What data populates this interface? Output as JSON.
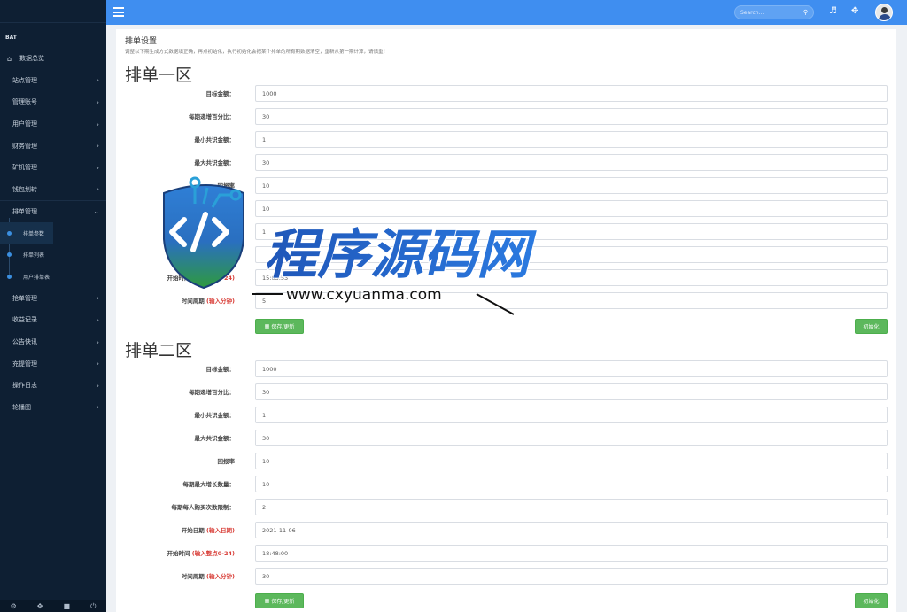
{
  "sidebar": {
    "brand": "BAT",
    "home": "数据总览",
    "items": [
      {
        "label": "站点管理"
      },
      {
        "label": "管理账号"
      },
      {
        "label": "用户管理"
      },
      {
        "label": "财务管理"
      },
      {
        "label": "矿机管理"
      },
      {
        "label": "钱包划转"
      }
    ],
    "open_item": "排单管理",
    "sub_items": [
      "排单参数",
      "排单列表",
      "用户排单表"
    ],
    "items_after": [
      {
        "label": "抢单管理"
      },
      {
        "label": "收益记录"
      },
      {
        "label": "公告快讯"
      },
      {
        "label": "充提管理"
      },
      {
        "label": "操作日志"
      },
      {
        "label": "轮播图"
      }
    ]
  },
  "header": {
    "search_placeholder": "Search..."
  },
  "page": {
    "title": "排单设置",
    "description": "调整以下期生成方式数据填正确，再点初始化，执行初始化会把某个排单的所有期数据清空，重新从第一期计算，请慎重！"
  },
  "zone1": {
    "title": "排单一区",
    "fields": [
      {
        "label": "目标金额：",
        "hint": "",
        "value": "1000"
      },
      {
        "label": "每期递增百分比：",
        "hint": "",
        "value": "30"
      },
      {
        "label": "最小共识金额：",
        "hint": "",
        "value": "1"
      },
      {
        "label": "最大共识金额：",
        "hint": "",
        "value": "30"
      },
      {
        "label": "回报率",
        "hint": "",
        "value": "10"
      },
      {
        "label": "",
        "hint": "",
        "value": "10"
      },
      {
        "label": "",
        "hint": "",
        "value": "1"
      },
      {
        "label": "",
        "hint": "",
        "value": ""
      },
      {
        "label": "开始时间 ",
        "hint": "(输入整点0-24)",
        "value": "15:03:53"
      },
      {
        "label": "时间周期 ",
        "hint": "(输入分钟)",
        "value": "5"
      }
    ],
    "save_label": "保存/更新",
    "init_label": "初始化"
  },
  "zone2": {
    "title": "排单二区",
    "fields": [
      {
        "label": "目标金额：",
        "hint": "",
        "value": "1000"
      },
      {
        "label": "每期递增百分比：",
        "hint": "",
        "value": "30"
      },
      {
        "label": "最小共识金额：",
        "hint": "",
        "value": "1"
      },
      {
        "label": "最大共识金额：",
        "hint": "",
        "value": "30"
      },
      {
        "label": "回报率",
        "hint": "",
        "value": "10"
      },
      {
        "label": "每期最大增长数量：",
        "hint": "",
        "value": "10"
      },
      {
        "label": "每期每人购买次数限制：",
        "hint": "",
        "value": "2"
      },
      {
        "label": "开始日期 ",
        "hint": "(输入日期)",
        "value": "2021-11-06"
      },
      {
        "label": "开始时间 ",
        "hint": "(输入整点0-24)",
        "value": "18:48:00"
      },
      {
        "label": "时间周期 ",
        "hint": "(输入分钟)",
        "value": "30"
      }
    ],
    "save_label": "保存/更新",
    "init_label": "初始化"
  },
  "watermark": {
    "text": "程序源码网",
    "url": "www.cxyuanma.com"
  },
  "colors": {
    "header": "#3f8ef0",
    "sidebar": "#0e1f33",
    "button": "#5cb85c",
    "hint": "#d9403a"
  }
}
